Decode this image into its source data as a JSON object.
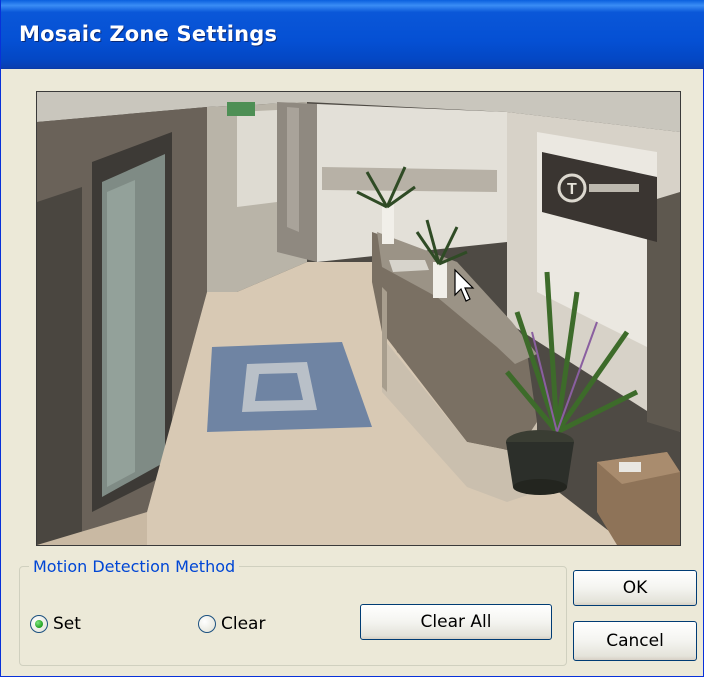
{
  "window": {
    "title": "Mosaic Zone Settings"
  },
  "camera": {
    "sign_text": "T"
  },
  "motion_detection": {
    "legend": "Motion Detection Method",
    "options": [
      {
        "label": "Set",
        "selected": true
      },
      {
        "label": "Clear",
        "selected": false
      }
    ],
    "clear_all_label": "Clear All"
  },
  "buttons": {
    "ok_label": "OK",
    "cancel_label": "Cancel"
  },
  "colors": {
    "title_bar": "#0550d4",
    "legend_text": "#0046d5",
    "dialog_bg": "#ece9d8",
    "radio_selected": "#21a121"
  }
}
